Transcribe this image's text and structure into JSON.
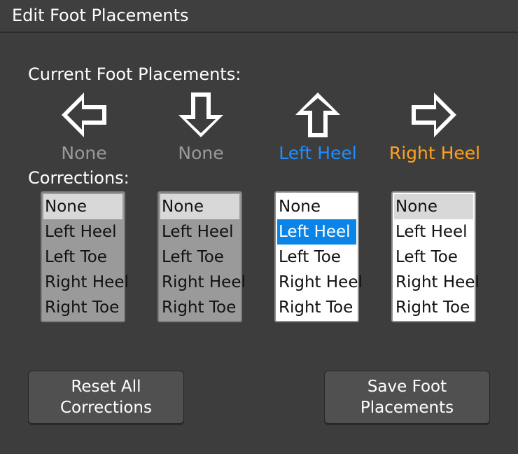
{
  "window": {
    "title": "Edit Foot Placements"
  },
  "current_label": "Current Foot Placements:",
  "corrections_label": "Corrections:",
  "columns": [
    {
      "arrow_icon": "arrow-left-icon",
      "placement": "None",
      "placement_color": "#9a9a9a",
      "enabled": false,
      "selected": "None"
    },
    {
      "arrow_icon": "arrow-down-icon",
      "placement": "None",
      "placement_color": "#9a9a9a",
      "enabled": false,
      "selected": "None"
    },
    {
      "arrow_icon": "arrow-up-icon",
      "placement": "Left Heel",
      "placement_color": "#1e8fff",
      "enabled": true,
      "selected": "Left Heel"
    },
    {
      "arrow_icon": "arrow-right-icon",
      "placement": "Right Heel",
      "placement_color": "#ffa21f",
      "enabled": true,
      "selected": "None"
    }
  ],
  "options": [
    "None",
    "Left Heel",
    "Left Toe",
    "Right Heel",
    "Right Toe"
  ],
  "buttons": {
    "reset": "Reset All\nCorrections",
    "save": "Save Foot\nPlacements"
  }
}
